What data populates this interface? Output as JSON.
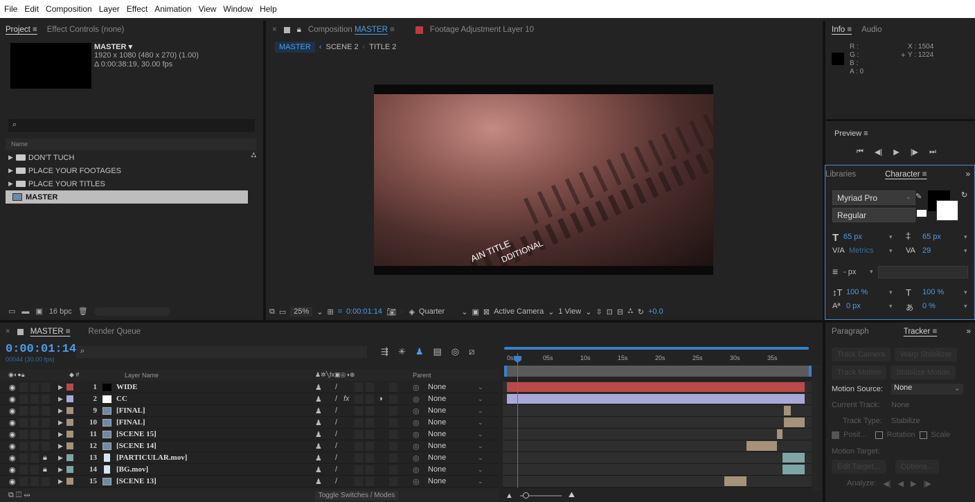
{
  "menu": [
    "File",
    "Edit",
    "Composition",
    "Layer",
    "Effect",
    "Animation",
    "View",
    "Window",
    "Help"
  ],
  "project": {
    "tab_project": "Project",
    "tab_effect_controls": "Effect Controls (none)",
    "comp_name": "MASTER",
    "comp_specs": "1920 x 1080  (480 x 270) (1.00)",
    "comp_duration": "Δ 0:00:38:19, 30.00 fps",
    "search_placeholder": "",
    "column_name": "Name",
    "items": [
      {
        "name": "DON'T TUCH",
        "type": "folder"
      },
      {
        "name": "PLACE YOUR FOOTAGES",
        "type": "folder"
      },
      {
        "name": "PLACE YOUR TITLES",
        "type": "folder"
      },
      {
        "name": "MASTER",
        "type": "comp",
        "selected": true
      }
    ],
    "bpc": "16 bpc"
  },
  "comp_viewer": {
    "tab_label": "Composition",
    "tab_comp": "MASTER",
    "footage_tab": "Footage Adjustment Layer 10",
    "breadcrumb": [
      "MASTER",
      "SCENE 2",
      "TITLE 2"
    ],
    "overlay_text_1": "AIN TITLE",
    "overlay_text_2": "DDITIONAL",
    "zoom": "25%",
    "timecode": "0:00:01:14",
    "resolution": "Quarter",
    "camera": "Active Camera",
    "views": "1 View",
    "exposure": "+0.0"
  },
  "info": {
    "tab_info": "Info",
    "tab_audio": "Audio",
    "r": "R :",
    "g": "G :",
    "b": "B :",
    "a": "A : 0",
    "x": "X : 1504",
    "y": "Y : 1224"
  },
  "preview": {
    "title": "Preview"
  },
  "character": {
    "tab_libraries": "Libraries",
    "tab_character": "Character",
    "font": "Myriad Pro",
    "style": "Regular",
    "size": "65 px",
    "leading": "65 px",
    "kerning": "Metrics",
    "tracking": "29",
    "stroke": "- px",
    "v_scale": "100 %",
    "h_scale": "100 %",
    "baseline": "0 px",
    "tsume": "0 %"
  },
  "tracker": {
    "tab_paragraph": "Paragraph",
    "tab_tracker": "Tracker",
    "track_camera": "Track Camera",
    "warp_stabilizer": "Warp Stabilizer",
    "track_motion": "Track Motion",
    "stabilize_motion": "Stabilize Motion",
    "motion_source_label": "Motion Source:",
    "motion_source_value": "None",
    "current_track": "Current Track:",
    "current_track_value": "None",
    "track_type": "Track Type:",
    "track_type_value": "Stabilize",
    "position": "Posit...",
    "rotation": "Rotation",
    "scale": "Scale",
    "motion_target": "Motion Target:",
    "edit_target": "Edit Target...",
    "options": "Options...",
    "analyze": "Analyze:"
  },
  "timeline": {
    "tab_master": "MASTER",
    "tab_render": "Render Queue",
    "timecode": "0:00:01:14",
    "frames": "00044 (30.00 fps)",
    "col_layer_name": "Layer Name",
    "col_parent": "Parent",
    "toggle_label": "Toggle Switches / Modes",
    "ruler": [
      "0s",
      "05s",
      "10s",
      "15s",
      "20s",
      "25s",
      "30s",
      "35s"
    ],
    "colors": {
      "red": "#b94a4a",
      "lavender": "#a9a9d8",
      "sand": "#a4937a",
      "teal": "#7fa5a5"
    },
    "layers": [
      {
        "num": "1",
        "name": "WIDE",
        "color": "#b94a4a",
        "icon": "solid-black",
        "fx": false,
        "lock": false,
        "parent": "None",
        "bar": "red"
      },
      {
        "num": "2",
        "name": "CC",
        "color": "#a9a9d8",
        "icon": "solid-white",
        "fx": true,
        "lock": false,
        "parent": "None",
        "bar": "lavender"
      },
      {
        "num": "9",
        "name": "[FINAL]",
        "color": "#a4937a",
        "icon": "comp",
        "fx": false,
        "lock": false,
        "parent": "None",
        "bar": "sand"
      },
      {
        "num": "10",
        "name": "[FINAL]",
        "color": "#a4937a",
        "icon": "comp",
        "fx": false,
        "lock": false,
        "parent": "None",
        "bar": "sand"
      },
      {
        "num": "11",
        "name": "[SCENE 15]",
        "color": "#a4937a",
        "icon": "comp",
        "fx": false,
        "lock": false,
        "parent": "None",
        "bar": "sand"
      },
      {
        "num": "12",
        "name": "[SCENE 14]",
        "color": "#a4937a",
        "icon": "comp",
        "fx": false,
        "lock": false,
        "parent": "None",
        "bar": "sand"
      },
      {
        "num": "13",
        "name": "[PARTICULAR.mov]",
        "color": "#7fa5a5",
        "icon": "file",
        "fx": false,
        "lock": true,
        "parent": "None",
        "bar": "teal"
      },
      {
        "num": "14",
        "name": "[BG.mov]",
        "color": "#7fa5a5",
        "icon": "file",
        "fx": false,
        "lock": true,
        "parent": "None",
        "bar": "teal"
      },
      {
        "num": "15",
        "name": "[SCENE 13]",
        "color": "#a4937a",
        "icon": "comp",
        "fx": false,
        "lock": false,
        "parent": "None",
        "bar": "sand"
      }
    ]
  }
}
